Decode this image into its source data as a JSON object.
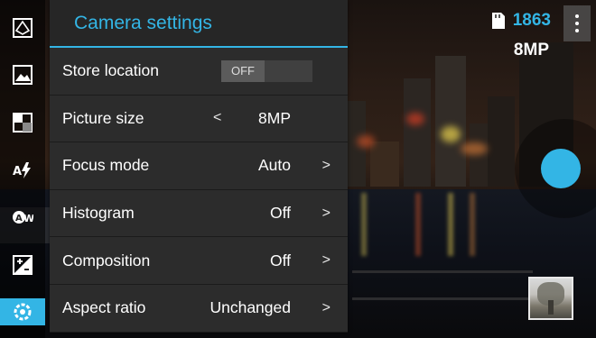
{
  "panel": {
    "title": "Camera settings",
    "rows": [
      {
        "label": "Store location",
        "toggle": "OFF"
      },
      {
        "label": "Picture size",
        "value": "8MP",
        "left_arrow": "<",
        "right_arrow": ""
      },
      {
        "label": "Focus mode",
        "value": "Auto",
        "right_arrow": ">"
      },
      {
        "label": "Histogram",
        "value": "Off",
        "right_arrow": ">"
      },
      {
        "label": "Composition",
        "value": "Off",
        "right_arrow": ">"
      },
      {
        "label": "Aspect ratio",
        "value": "Unchanged",
        "right_arrow": ">"
      }
    ]
  },
  "status": {
    "remaining_shots": "1863",
    "resolution": "8MP"
  },
  "sidebar": {
    "icons": [
      "exposure-frame-icon",
      "scene-landscape-icon",
      "white-balance-icon",
      "auto-flash-icon",
      "auto-white-balance-icon",
      "exposure-compensation-icon",
      "settings-icon"
    ]
  },
  "colors": {
    "accent": "#33b5e5",
    "panel_bg": "#2c2c2c"
  }
}
